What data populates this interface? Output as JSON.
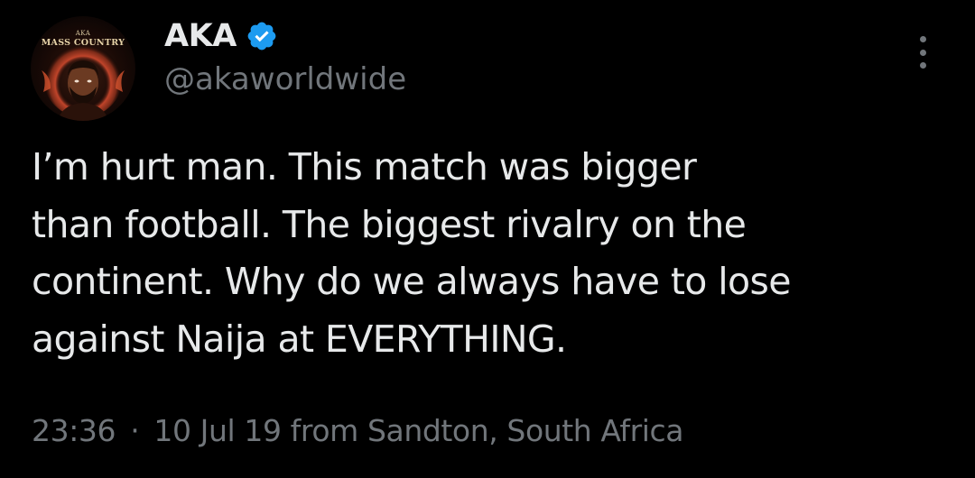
{
  "author": {
    "display_name": "AKA",
    "handle": "@akaworldwide",
    "verified": true,
    "avatar_icon": "profile-avatar-icon",
    "avatar_text_top": "AKA",
    "avatar_text_main": "MASS COUNTRY"
  },
  "tweet": {
    "text": "I’m hurt man. This match was bigger\nthan football. The biggest rivalry on the\ncontinent. Why do we always have to lose\nagainst Naija at EVERYTHING."
  },
  "meta": {
    "time": "23:36",
    "separator": "·",
    "date": "10 Jul 19",
    "source": "from Sandton, South Africa"
  },
  "colors": {
    "background": "#000000",
    "text_primary": "#e7e9ea",
    "text_secondary": "#71767b",
    "verified_blue": "#1d9bf0"
  },
  "icons": {
    "verified": "verified-badge-icon",
    "more": "more-options-icon"
  }
}
